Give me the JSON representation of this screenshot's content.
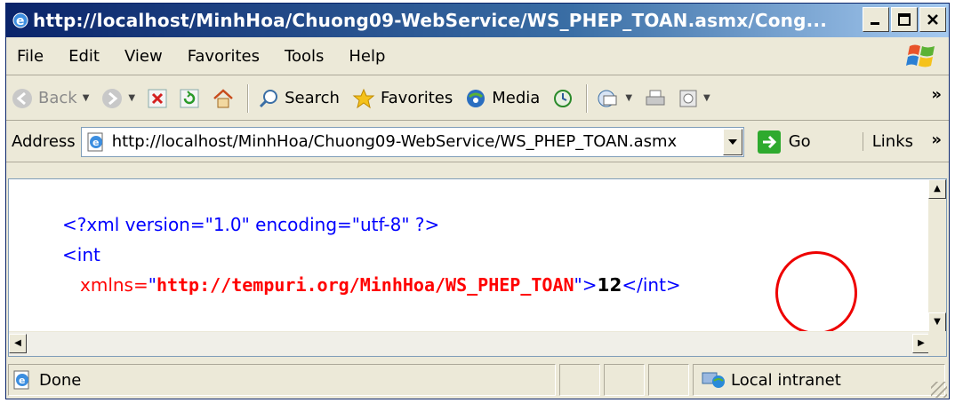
{
  "window": {
    "title": "http://localhost/MinhHoa/Chuong09-WebService/WS_PHEP_TOAN.asmx/Cong..."
  },
  "menu": {
    "items": [
      "File",
      "Edit",
      "View",
      "Favorites",
      "Tools",
      "Help"
    ]
  },
  "toolbar": {
    "back_label": "Back",
    "search_label": "Search",
    "favorites_label": "Favorites",
    "media_label": "Media"
  },
  "address": {
    "label": "Address",
    "url": "http://localhost/MinhHoa/Chuong09-WebService/WS_PHEP_TOAN.asmx",
    "go_label": "Go",
    "links_label": "Links"
  },
  "content": {
    "line1": "<?xml version=\"1.0\" encoding=\"utf-8\" ?>",
    "line2": "<int",
    "attr_name": "xmlns=",
    "quote_open": "\"",
    "attr_value": "http://tempuri.org/MinhHoa/WS_PHEP_TOAN",
    "quote_close": "\">",
    "result": "12",
    "close_tag": "</int>"
  },
  "status": {
    "text": "Done",
    "zone": "Local intranet"
  },
  "colors": {
    "xml_tag": "#0000ff",
    "xml_attr_value": "#ff0000",
    "highlight_circle": "#e00000"
  }
}
